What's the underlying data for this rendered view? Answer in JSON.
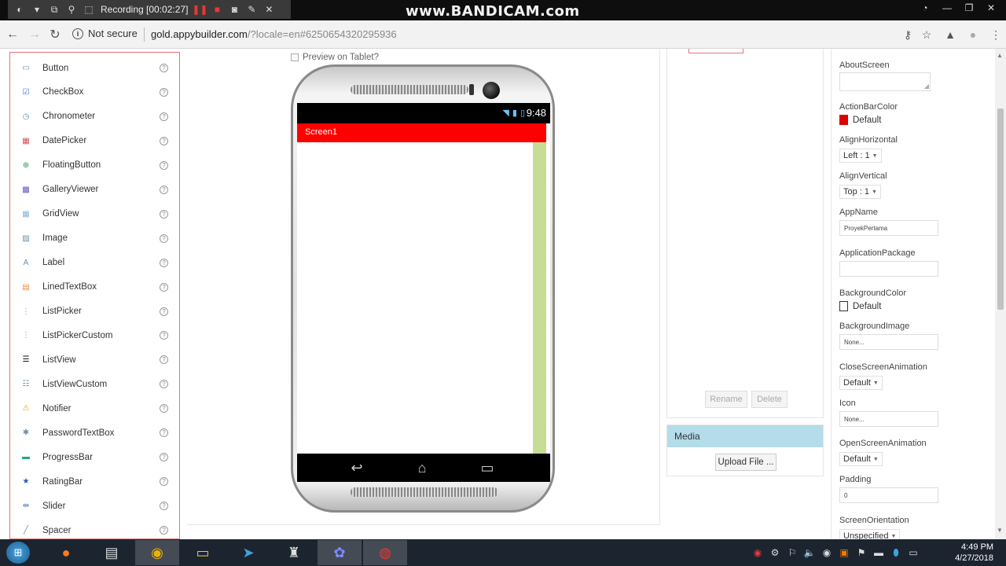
{
  "recorder": {
    "status": "Recording [00:02:27]",
    "watermark": "www.BANDICAM.com"
  },
  "browser": {
    "security_label": "Not secure",
    "url_host": "gold.appybuilder.com",
    "url_path": "/?locale=en#6250654320295936"
  },
  "palette": {
    "items": [
      {
        "label": "Button",
        "icon": "button-icon"
      },
      {
        "label": "CheckBox",
        "icon": "checkbox-icon"
      },
      {
        "label": "Chronometer",
        "icon": "chronometer-icon"
      },
      {
        "label": "DatePicker",
        "icon": "datepicker-icon"
      },
      {
        "label": "FloatingButton",
        "icon": "floating-button-icon"
      },
      {
        "label": "GalleryViewer",
        "icon": "gallery-icon"
      },
      {
        "label": "GridView",
        "icon": "gridview-icon"
      },
      {
        "label": "Image",
        "icon": "image-icon"
      },
      {
        "label": "Label",
        "icon": "label-icon"
      },
      {
        "label": "LinedTextBox",
        "icon": "lined-textbox-icon"
      },
      {
        "label": "ListPicker",
        "icon": "listpicker-icon"
      },
      {
        "label": "ListPickerCustom",
        "icon": "listpicker-custom-icon"
      },
      {
        "label": "ListView",
        "icon": "listview-icon"
      },
      {
        "label": "ListViewCustom",
        "icon": "listview-custom-icon"
      },
      {
        "label": "Notifier",
        "icon": "notifier-icon"
      },
      {
        "label": "PasswordTextBox",
        "icon": "password-icon"
      },
      {
        "label": "ProgressBar",
        "icon": "progressbar-icon"
      },
      {
        "label": "RatingBar",
        "icon": "star-icon"
      },
      {
        "label": "Slider",
        "icon": "slider-icon"
      },
      {
        "label": "Spacer",
        "icon": "spacer-icon"
      }
    ],
    "help_glyph": "?"
  },
  "viewer": {
    "tablet_preview_label": "Preview on Tablet?",
    "status_time": "9:48",
    "screen_title": "Screen1"
  },
  "components": {
    "rename_label": "Rename",
    "delete_label": "Delete"
  },
  "media": {
    "title": "Media",
    "upload_label": "Upload File ..."
  },
  "properties": {
    "about_screen": {
      "label": "AboutScreen"
    },
    "action_bar_color": {
      "label": "ActionBarColor",
      "value": "Default",
      "color": "#dd0000"
    },
    "align_horizontal": {
      "label": "AlignHorizontal",
      "value": "Left : 1"
    },
    "align_vertical": {
      "label": "AlignVertical",
      "value": "Top : 1"
    },
    "app_name": {
      "label": "AppName",
      "value": "ProyekPertama"
    },
    "application_package": {
      "label": "ApplicationPackage",
      "value": ""
    },
    "background_color": {
      "label": "BackgroundColor",
      "value": "Default",
      "color": "#ffffff"
    },
    "background_image": {
      "label": "BackgroundImage",
      "value": "None..."
    },
    "close_screen_animation": {
      "label": "CloseScreenAnimation",
      "value": "Default"
    },
    "icon": {
      "label": "Icon",
      "value": "None..."
    },
    "open_screen_animation": {
      "label": "OpenScreenAnimation",
      "value": "Default"
    },
    "padding": {
      "label": "Padding",
      "value": "0"
    },
    "screen_orientation": {
      "label": "ScreenOrientation",
      "value": "Unspecified"
    }
  },
  "taskbar": {
    "time": "4:49 PM",
    "date": "4/27/2018"
  }
}
